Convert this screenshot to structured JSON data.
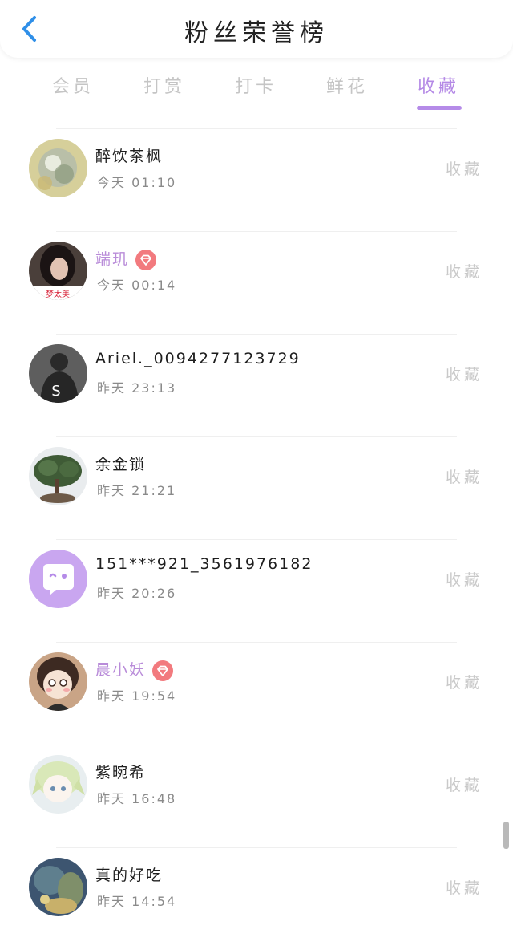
{
  "header": {
    "title": "粉丝荣誉榜",
    "back_icon": "chevron-left-icon",
    "accent": "#2f8fe8"
  },
  "tabs": [
    {
      "label": "会员"
    },
    {
      "label": "打赏"
    },
    {
      "label": "打卡"
    },
    {
      "label": "鲜花"
    },
    {
      "label": "收藏"
    }
  ],
  "active_tab": "收藏",
  "active_color": "#b58be8",
  "fans": [
    {
      "name": "醉饮茶枫",
      "time": "今天 01:10",
      "action": "收藏",
      "vip": false
    },
    {
      "name": "端玑",
      "time": "今天 00:14",
      "action": "收藏",
      "vip": true
    },
    {
      "name": "Ariel._0094277123729",
      "time": "昨天 23:13",
      "action": "收藏",
      "vip": false
    },
    {
      "name": "余金锁",
      "time": "昨天 21:21",
      "action": "收藏",
      "vip": false
    },
    {
      "name": "151***921_3561976182",
      "time": "昨天 20:26",
      "action": "收藏",
      "vip": false
    },
    {
      "name": "晨小妖",
      "time": "昨天 19:54",
      "action": "收藏",
      "vip": true
    },
    {
      "name": "紫晼希",
      "time": "昨天 16:48",
      "action": "收藏",
      "vip": false
    },
    {
      "name": "真的好吃",
      "time": "昨天 14:54",
      "action": "收藏",
      "vip": false
    }
  ],
  "avatar_text": {
    "ariel": "S",
    "duanji": "梦太美"
  }
}
